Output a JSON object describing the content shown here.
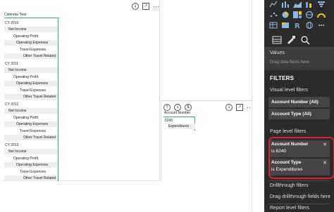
{
  "toolbar_icons": [
    "back-icon",
    "refresh-icon",
    "more-icon"
  ],
  "visual1": {
    "header": "Calendar Year",
    "rows": [
      {
        "label": "CY 2010",
        "indent": 0
      },
      {
        "label": "Net Income",
        "indent": 1
      },
      {
        "label": "Operating Profit",
        "indent": 2
      },
      {
        "label": "Operating Expenses",
        "indent": 3
      },
      {
        "label": "Travel Expenses",
        "indent": 4
      },
      {
        "label": "Other Travel Related",
        "indent": 5
      },
      {
        "label": "CY 2011",
        "indent": 0
      },
      {
        "label": "Net Income",
        "indent": 1
      },
      {
        "label": "Operating Profit",
        "indent": 2
      },
      {
        "label": "Operating Expenses",
        "indent": 3
      },
      {
        "label": "Travel Expenses",
        "indent": 4
      },
      {
        "label": "Other Travel Related",
        "indent": 5
      },
      {
        "label": "CY 2012",
        "indent": 0
      },
      {
        "label": "Net Income",
        "indent": 1
      },
      {
        "label": "Operating Profit",
        "indent": 2
      },
      {
        "label": "Operating Expenses",
        "indent": 3
      },
      {
        "label": "Travel Expenses",
        "indent": 4
      },
      {
        "label": "Other Travel Related",
        "indent": 5
      },
      {
        "label": "CY 2013",
        "indent": 0
      },
      {
        "label": "Net Income",
        "indent": 1
      },
      {
        "label": "Operating Profit",
        "indent": 2
      },
      {
        "label": "Operating Expenses",
        "indent": 3
      },
      {
        "label": "Travel Expenses",
        "indent": 4
      },
      {
        "label": "Other Travel Related",
        "indent": 5
      }
    ]
  },
  "visual2": {
    "header": "Account Number",
    "rows": [
      {
        "label": "6240",
        "indent": 0
      },
      {
        "label": "Expenditures",
        "indent": 1
      }
    ]
  },
  "pane": {
    "values_label": "Values",
    "values_placeholder": "Drag data fields here",
    "filters_title": "FILTERS",
    "visual_level_label": "Visual level filters",
    "visual_filters": [
      {
        "name": "Account Number (All)"
      },
      {
        "name": "Account Type (All)"
      }
    ],
    "page_level_label": "Page level filters",
    "page_filters": [
      {
        "name": "Account Number",
        "value": "is 6240"
      },
      {
        "name": "Account Type",
        "value": "is Expenditures"
      }
    ],
    "drillthrough_label": "Drillthrough filters",
    "drillthrough_placeholder": "Drag drillthrough fields here",
    "report_level_label": "Report level filters"
  },
  "colors": {
    "accent": "#2ea9a1",
    "pane_bg": "#2b2b2b",
    "highlight": "#e0202a",
    "tab_active": "#f2c811"
  }
}
